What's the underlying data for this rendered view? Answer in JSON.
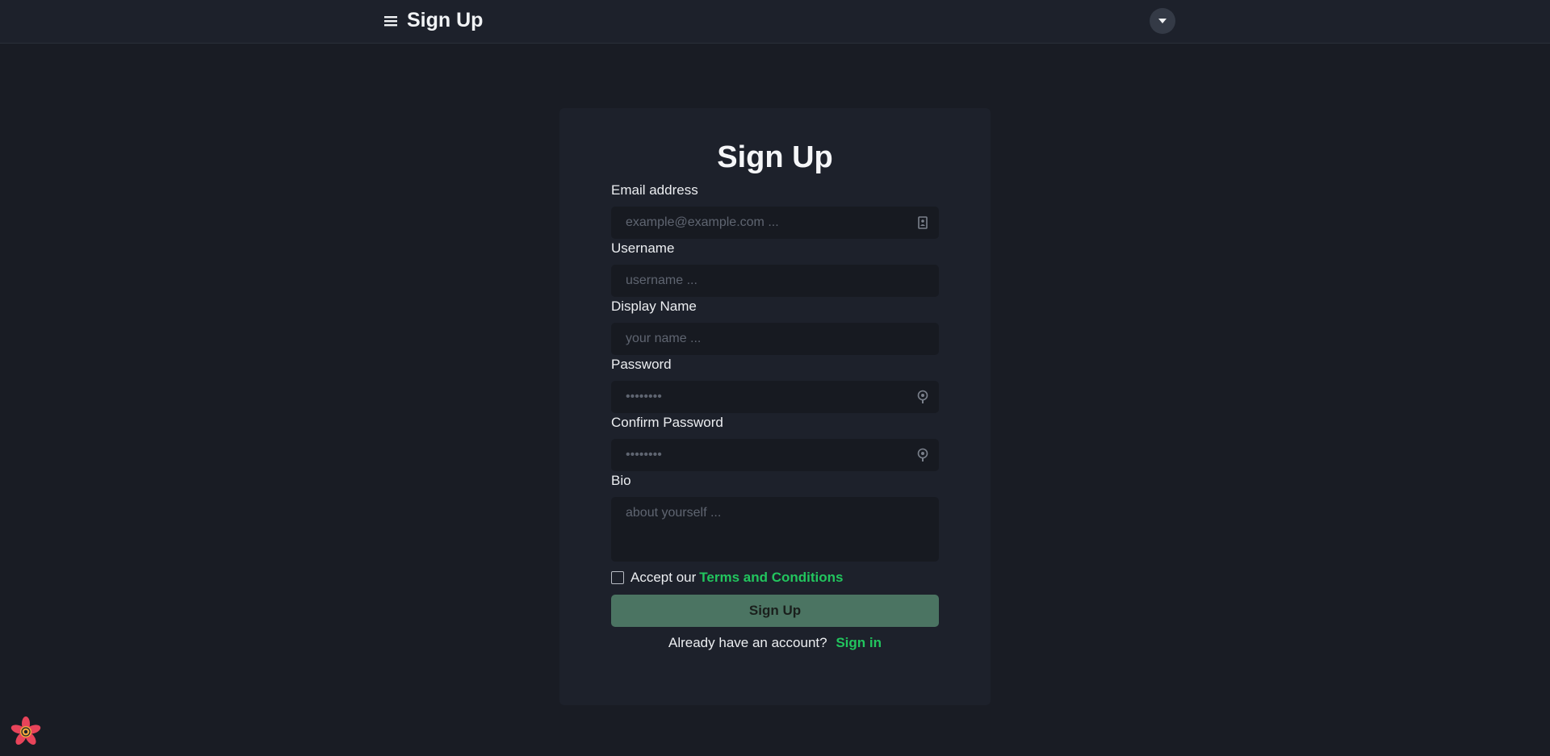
{
  "header": {
    "title": "Sign Up",
    "menu_icon": "hamburger-menu-icon",
    "user_menu_icon": "caret-down-icon"
  },
  "form": {
    "title": "Sign Up",
    "fields": [
      {
        "label": "Email address",
        "placeholder": "example@example.com ...",
        "value": "",
        "icon": "contact-card-icon"
      },
      {
        "label": "Username",
        "placeholder": "username ...",
        "value": ""
      },
      {
        "label": "Display Name",
        "placeholder": "your name ...",
        "value": ""
      },
      {
        "label": "Password",
        "placeholder": "••••••••",
        "value": "",
        "icon": "key-icon"
      },
      {
        "label": "Confirm Password",
        "placeholder": "••••••••",
        "value": "",
        "icon": "key-icon"
      },
      {
        "label": "Bio",
        "placeholder": "about yourself ...",
        "value": ""
      }
    ],
    "terms": {
      "prefix": "Accept our",
      "link": "Terms and Conditions",
      "checked": false
    },
    "submit_label": "Sign Up",
    "signin_prompt": "Already have an account?",
    "signin_link": "Sign in"
  },
  "colors": {
    "page_bg": "#191c24",
    "card_bg": "#1d212b",
    "input_bg": "#171a21",
    "accent": "#22c55e",
    "button_bg": "#4b7462"
  },
  "logo_icon": "flower-logo-icon"
}
